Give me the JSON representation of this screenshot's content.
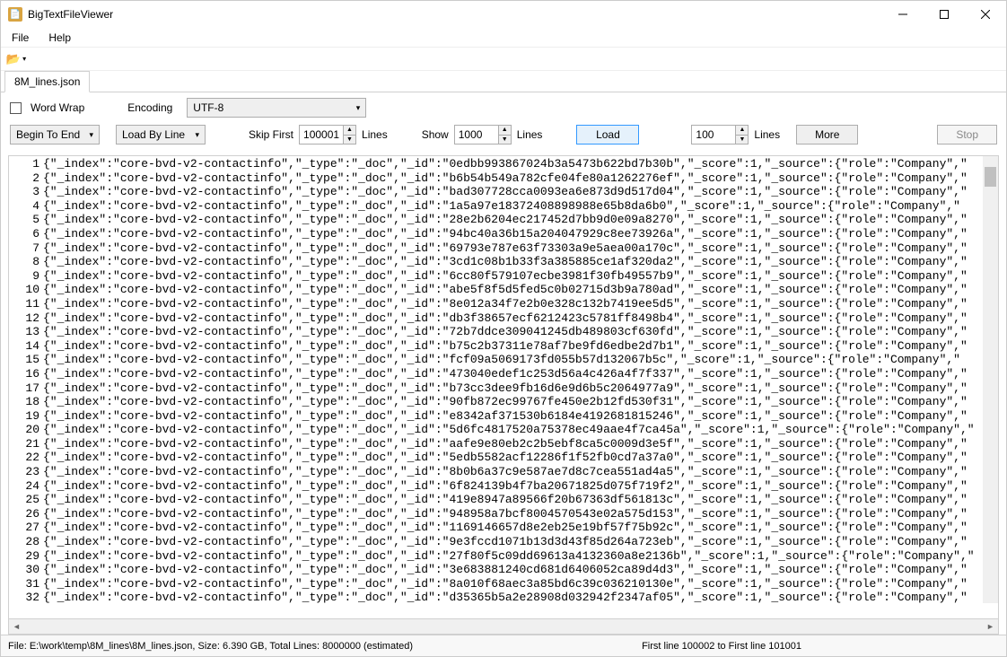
{
  "window": {
    "title": "BigTextFileViewer"
  },
  "menu": {
    "file": "File",
    "help": "Help"
  },
  "tab": {
    "name": "8M_lines.json"
  },
  "controls": {
    "word_wrap_label": "Word Wrap",
    "encoding_label": "Encoding",
    "encoding_value": "UTF-8",
    "direction": "Begin To End",
    "load_mode": "Load By Line",
    "skip_first_label": "Skip First",
    "skip_first_value": "100001",
    "skip_first_unit": "Lines",
    "show_label": "Show",
    "show_value": "1000",
    "show_unit": "Lines",
    "load_btn": "Load",
    "more_value": "100",
    "more_unit": "Lines",
    "more_btn": "More",
    "stop_btn": "Stop"
  },
  "text": {
    "prefix": "{\"_index\":\"core-bvd-v2-contactinfo\",\"_type\":\"_doc\",\"_id\":\"",
    "suffix": "\",\"_score\":1,\"_source\":{\"role\":\"Company\",\"",
    "ids": [
      "0edbb993867024b3a5473b622bd7b30b",
      "b6b54b549a782cfe04fe80a1262276ef",
      "bad307728cca0093ea6e873d9d517d04",
      "1a5a97e18372408898988e65b8da6b0",
      "28e2b6204ec217452d7bb9d0e09a8270",
      "94bc40a36b15a204047929c8ee73926a",
      "69793e787e63f73303a9e5aea00a170c",
      "3cd1c08b1b33f3a385885ce1af320da2",
      "6cc80f579107ecbe3981f30fb49557b9",
      "abe5f8f5d5fed5c0b02715d3b9a780ad",
      "8e012a34f7e2b0e328c132b7419ee5d5",
      "db3f38657ecf6212423c5781ff8498b4",
      "72b7ddce309041245db489803cf630fd",
      "b75c2b37311e78af7be9fd6edbe2d7b1",
      "fcf09a5069173fd055b57d132067b5c",
      "473040edef1c253d56a4c426a4f7f337",
      "b73cc3dee9fb16d6e9d6b5c2064977a9",
      "90fb872ec99767fe450e2b12fd530f31",
      "e8342af371530b6184e4192681815246",
      "5d6fc4817520a75378ec49aae4f7ca45a",
      "aafe9e80eb2c2b5ebf8ca5c0009d3e5f",
      "5edb5582acf12286f1f52fb0cd7a37a0",
      "8b0b6a37c9e587ae7d8c7cea551ad4a5",
      "6f824139b4f7ba20671825d075f719f2",
      "419e8947a89566f20b67363df561813c",
      "948958a7bcf8004570543e02a575d153",
      "1169146657d8e2eb25e19bf57f75b92c",
      "9e3fccd1071b13d3d43f85d264a723eb",
      "27f80f5c09dd69613a4132360a8e2136b",
      "3e683881240cd681d6406052ca89d4d3",
      "8a010f68aec3a85bd6c39c036210130e",
      "d35365b5a2e28908d032942f2347af05"
    ]
  },
  "status": {
    "left": "File: E:\\work\\temp\\8M_lines\\8M_lines.json, Size:    6.390 GB, Total Lines: 8000000 (estimated)",
    "right": "First line 100002 to First line 101001"
  }
}
